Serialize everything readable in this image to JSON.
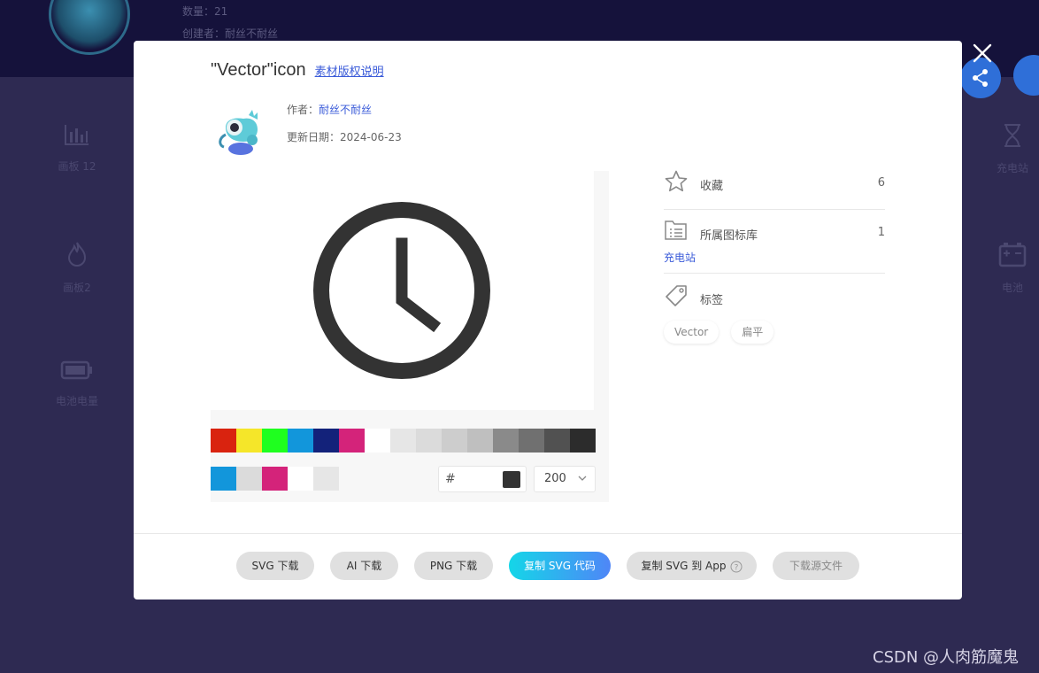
{
  "background": {
    "count_line": "数量：21",
    "creator_line": "创建者：耐丝不耐丝",
    "left_items": [
      {
        "label": "画板 12",
        "icon": "bar-chart-icon"
      },
      {
        "label": "画板2",
        "icon": "flame-icon"
      },
      {
        "label": "电池电量",
        "icon": "battery-icon"
      }
    ],
    "right_items": [
      {
        "label": "充电站",
        "icon": "hourglass-icon"
      },
      {
        "label": "电池",
        "icon": "battery-plus-minus-icon"
      }
    ]
  },
  "modal": {
    "title": "\"Vector\"icon",
    "license_link": "素材版权说明",
    "author_label": "作者：",
    "author_name": "耐丝不耐丝",
    "date_line": "更新日期：2024-06-23",
    "preview_icon": "clock-icon",
    "icon_color": "#333333",
    "palette": [
      "#d9230f",
      "#f5e629",
      "#1fff1f",
      "#1296db",
      "#13227a",
      "#d4237a",
      "#ffffff",
      "#e6e6e6",
      "#dbdbdb",
      "#cdcdcd",
      "#bfbfbf",
      "#8a8a8a",
      "#707070",
      "#515151",
      "#2c2c2c"
    ],
    "recent_colors": [
      "#1296db",
      "#dbdbdb",
      "#d4237a",
      "#ffffff",
      "#e6e6e6"
    ],
    "hex": {
      "hash": "#",
      "value": "",
      "preview_color": "#333333"
    },
    "size": "200",
    "stats": {
      "favorite_label": "收藏",
      "favorite_count": "6",
      "library_label": "所属图标库",
      "library_count": "1",
      "library_name": "充电站",
      "tags_label": "标签",
      "tags": [
        "Vector",
        "扁平"
      ]
    },
    "buttons": {
      "svg_download": "SVG 下载",
      "ai_download": "AI 下载",
      "png_download": "PNG 下载",
      "copy_svg": "复制 SVG 代码",
      "copy_to_app": "复制 SVG 到 App",
      "source_download": "下载源文件"
    }
  },
  "watermark": "CSDN @人肉筋魔鬼"
}
